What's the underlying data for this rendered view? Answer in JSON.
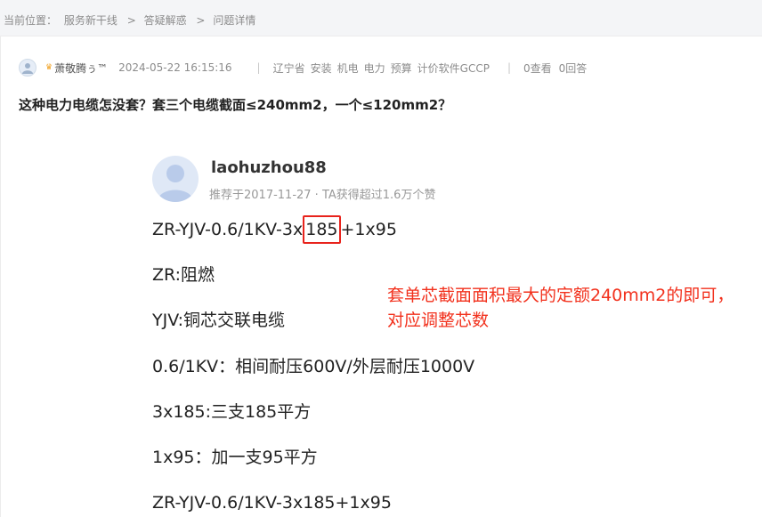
{
  "breadcrumb": {
    "label": "当前位置：",
    "items": [
      "服务新干线",
      "答疑解惑",
      "问题详情"
    ],
    "separator": ">"
  },
  "question": {
    "author": "萧敬腾ぅ™",
    "time": "2024-05-22 16:15:16",
    "region": "辽宁省",
    "tags": [
      "安装",
      "机电",
      "电力",
      "预算",
      "计价软件GCCP"
    ],
    "views": "0查看",
    "answers": "0回答",
    "title": "这种电力电缆怎没套？套三个电缆截面≤240mm2，一个≤120mm2？"
  },
  "answer": {
    "author": "laohuzhou88",
    "info": "推荐于2017-11-27 · TA获得超过1.6万个赞",
    "line1_pre": "ZR-YJV-0.6/1KV-3x",
    "line1_hl": "185",
    "line1_post": "+1x95",
    "lines": [
      "ZR:阻燃",
      "YJV:铜芯交联电缆",
      "0.6/1KV：相间耐压600V/外层耐压1000V",
      "3x185:三支185平方",
      "1x95：加一支95平方",
      "ZR-YJV-0.6/1KV-3x185+1x95"
    ],
    "annotation": "套单芯截面面积最大的定额240mm2的即可，对应调整芯数"
  },
  "colors": {
    "annotation": "#f2311d",
    "highlight_border": "#e8231c",
    "background": "#f4f5f7",
    "card": "#ffffff"
  }
}
